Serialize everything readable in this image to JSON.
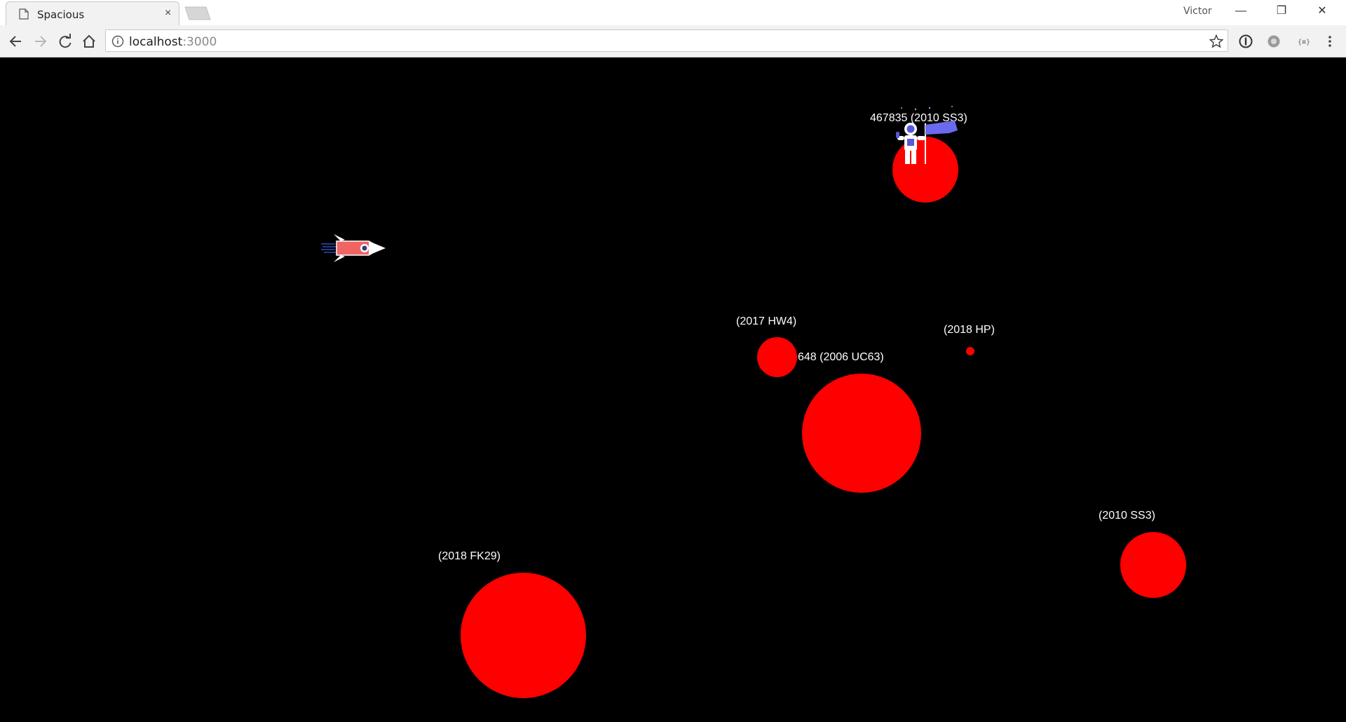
{
  "browser": {
    "tab_title": "Spacious",
    "tab_close": "×",
    "profile_name": "Victor",
    "url_host": "localhost",
    "url_port": ":3000",
    "icons": [
      "page-icon",
      "back-icon",
      "forward-icon",
      "reload-icon",
      "home-icon",
      "info-icon",
      "star-icon",
      "extension-icon"
    ]
  },
  "window_controls": {
    "minimize": "—",
    "restore": "❐",
    "close": "✕"
  },
  "scene": {
    "background": "#000000",
    "asteroid_color": "#ff0000",
    "labels": {
      "a1": "467835 (2010 SS3)",
      "a2": "(2017 HW4)",
      "a3": "(2018 HP)",
      "a4": "648 (2006 UC63)",
      "a5": "(2010 SS3)",
      "a6": "(2018 FK29)"
    },
    "sprites": [
      "rocket",
      "astronaut-with-flag"
    ]
  }
}
